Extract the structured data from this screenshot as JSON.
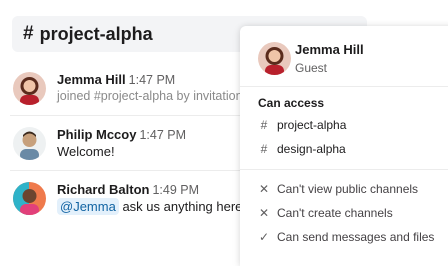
{
  "channel": {
    "hash": "#",
    "name": "project-alpha"
  },
  "messages": [
    {
      "author": "Jemma Hill",
      "time": "1:47 PM",
      "text": "joined #project-alpha by invitation"
    },
    {
      "author": "Philip Mccoy",
      "time": "1:47 PM",
      "text": "Welcome!"
    },
    {
      "author": "Richard Balton",
      "time": "1:49 PM",
      "mention": "@Jemma",
      "text": " ask us anything here"
    }
  ],
  "popover": {
    "name": "Jemma Hill",
    "role": "Guest",
    "access_title": "Can access",
    "channels": [
      "project-alpha",
      "design-alpha"
    ],
    "permissions": [
      {
        "icon": "x-icon",
        "label": "Can't view public channels"
      },
      {
        "icon": "x-icon",
        "label": "Can't create channels"
      },
      {
        "icon": "check-icon",
        "label": "Can send messages and files"
      }
    ]
  },
  "colors": {
    "mention_bg": "#e3f0fb",
    "mention_text": "#1264a3",
    "header_bg": "#f3f4f6"
  }
}
